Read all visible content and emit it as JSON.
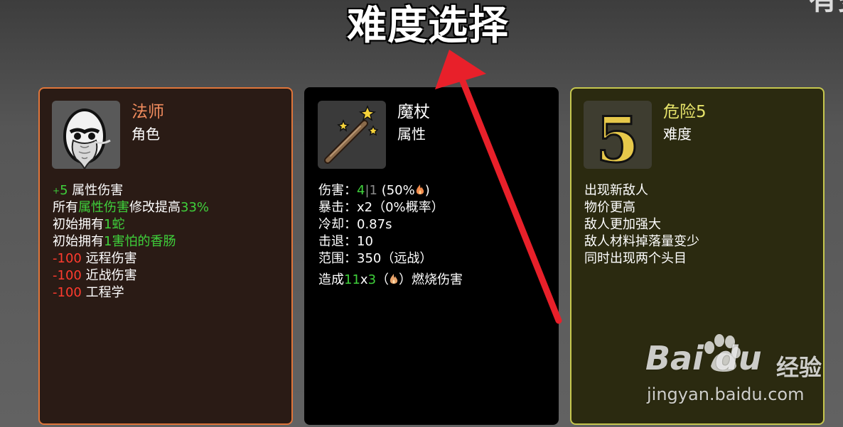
{
  "page": {
    "title": "难度选择",
    "corner_text": "有多"
  },
  "cards": [
    {
      "name": "法师",
      "type": "角色",
      "name_color": "#f38d5e",
      "border_color": "#e0753a",
      "icon": "mage-egg-icon",
      "stats": [
        {
          "prefix": "+",
          "value": "5",
          "label": " 属性伤害"
        },
        {
          "text1": "所有",
          "highlight": "属性伤害",
          "text2": "修改提高",
          "value": "33%"
        },
        {
          "text1": "初始拥有",
          "highlight": "1蛇"
        },
        {
          "text1": "初始拥有",
          "highlight": "1害怕的香肠"
        },
        {
          "value": "-100",
          "label": " 远程伤害"
        },
        {
          "value": "-100",
          "label": " 近战伤害"
        },
        {
          "value": "-100",
          "label": " 工程学"
        }
      ]
    },
    {
      "name": "魔杖",
      "type": "属性",
      "icon": "magic-wand-icon",
      "stats": [
        {
          "label": "伤害：",
          "value": "4",
          "sep": "|",
          "grey": "1",
          "paren_open": " (50%",
          "paren_close": ")"
        },
        {
          "label": "暴击：",
          "text": "x2（0%概率）"
        },
        {
          "label": "冷却：",
          "text": "0.87s"
        },
        {
          "label": "击退：",
          "text": "10"
        },
        {
          "label": "范围：",
          "text": "350（远战）"
        },
        {
          "pre": "造成",
          "v1": "11",
          "x": "x",
          "v2": "3",
          "mid_open": "（",
          "mid_close": "）",
          "post": "燃烧伤害"
        }
      ]
    },
    {
      "name": "危险5",
      "type": "难度",
      "name_color": "#e6e36a",
      "border_color": "#c6c74e",
      "icon": "danger-5-icon",
      "icon_digit": "5",
      "stats": [
        "出现新敌人",
        "物价更高",
        "敌人更加强大",
        "敌人材料掉落量变少",
        "同时出现两个头目"
      ]
    }
  ],
  "watermark": {
    "brand": "Bai  du",
    "brand_cn": "经验",
    "url": "jingyan.baidu.com"
  },
  "colors": {
    "positive": "#3fd13b",
    "negative": "#ff3b2e",
    "arrow": "#e8202a"
  }
}
